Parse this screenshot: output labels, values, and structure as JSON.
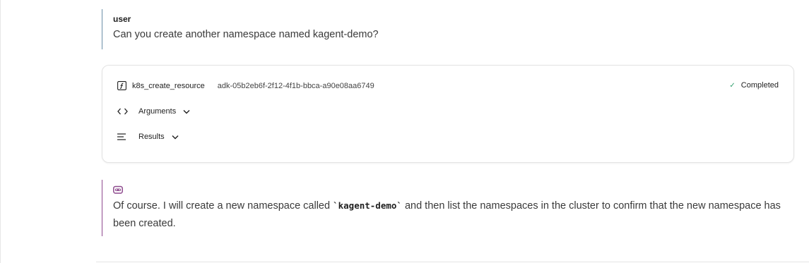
{
  "user_message": {
    "role": "user",
    "text": "Can you create another namespace named kagent-demo?"
  },
  "tool_call": {
    "icon": "function-icon",
    "name": "k8s_create_resource",
    "call_id": "adk-05b2eb6f-2f12-4f1b-bbca-a90e08aa6749",
    "status_icon": "check-icon",
    "status": "Completed",
    "status_color": "#2e9e6b",
    "sections": [
      {
        "icon": "code-brackets-icon",
        "label": "Arguments"
      },
      {
        "icon": "lines-icon",
        "label": "Results"
      }
    ]
  },
  "agent_message": {
    "avatar_icon": "robot-icon",
    "avatar_color": "#8e4a8e",
    "text_before": "Of course. I will create a new namespace called ",
    "code": "`kagent-demo`",
    "text_after": " and then list the namespaces in the cluster to confirm that the new namespace has been created."
  }
}
